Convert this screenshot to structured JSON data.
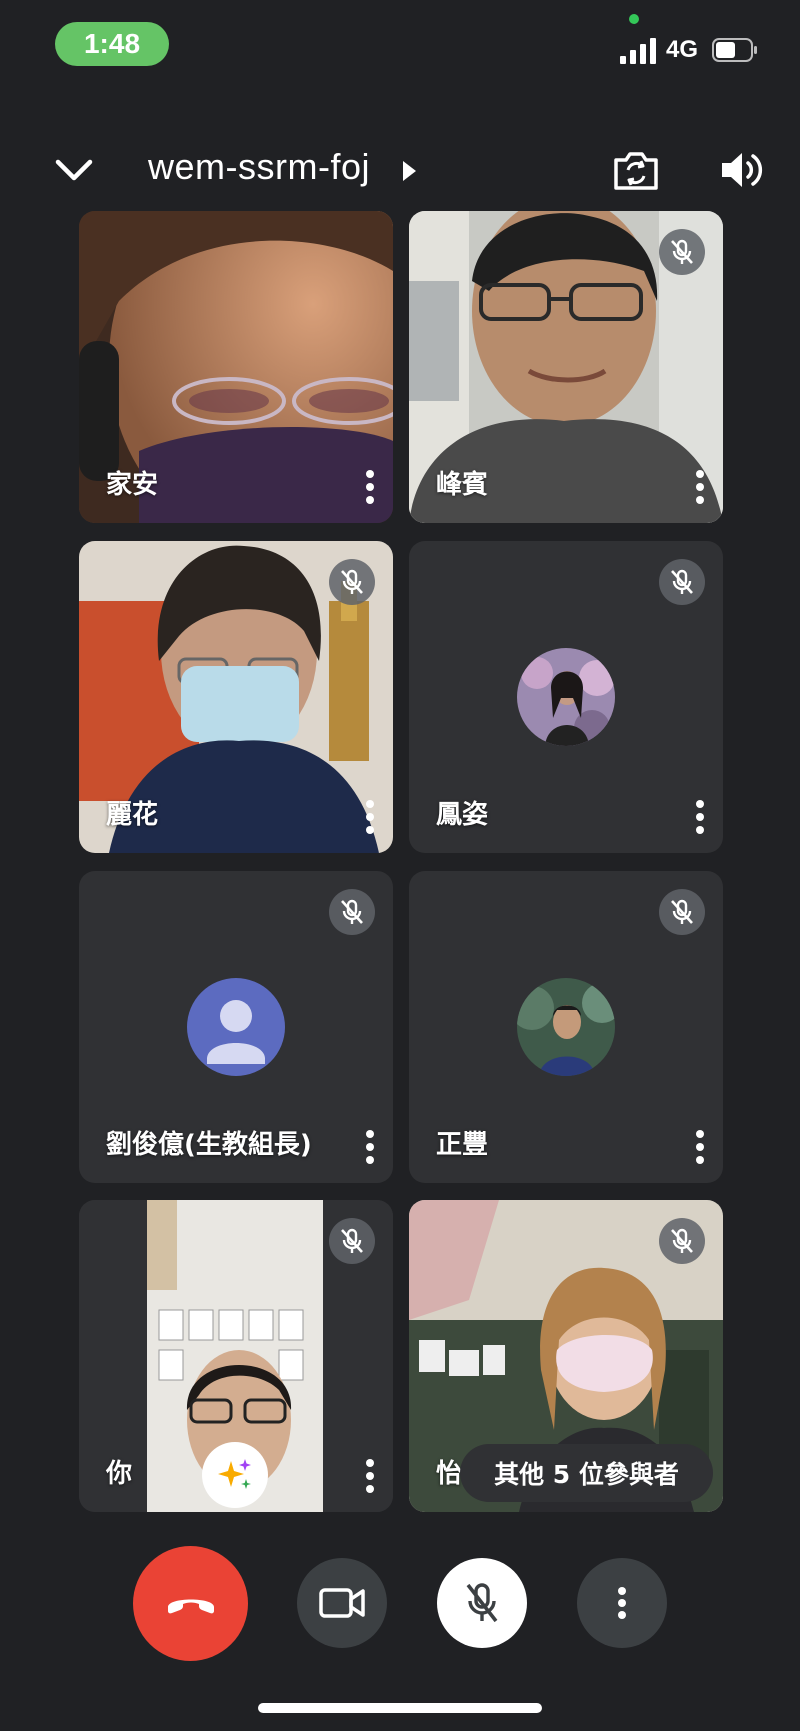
{
  "status_bar": {
    "time": "1:48",
    "network": "4G"
  },
  "header": {
    "meeting_code": "wem-ssrm-foj"
  },
  "participants": [
    {
      "name": "家安",
      "muted": false,
      "video": true
    },
    {
      "name": "峰賓",
      "muted": true,
      "video": true
    },
    {
      "name": "麗花",
      "muted": true,
      "video": true
    },
    {
      "name": "鳳姿",
      "muted": true,
      "video": false
    },
    {
      "name": "劉俊億(生教組長)",
      "muted": true,
      "video": false
    },
    {
      "name": "正豐",
      "muted": true,
      "video": false
    },
    {
      "name": "你",
      "muted": true,
      "video": true
    },
    {
      "name": "怡",
      "muted": true,
      "video": true
    }
  ],
  "others_pill": "其他 5 位參與者",
  "controls": {
    "end_call": "end-call-icon",
    "camera": "video-camera-icon",
    "mic": "mic-off-icon",
    "more": "more-vert-icon"
  },
  "colors": {
    "background": "#202124",
    "end_call": "#ea4335",
    "status_time_pill": "#65c466",
    "default_avatar": "#5c6bc0"
  }
}
